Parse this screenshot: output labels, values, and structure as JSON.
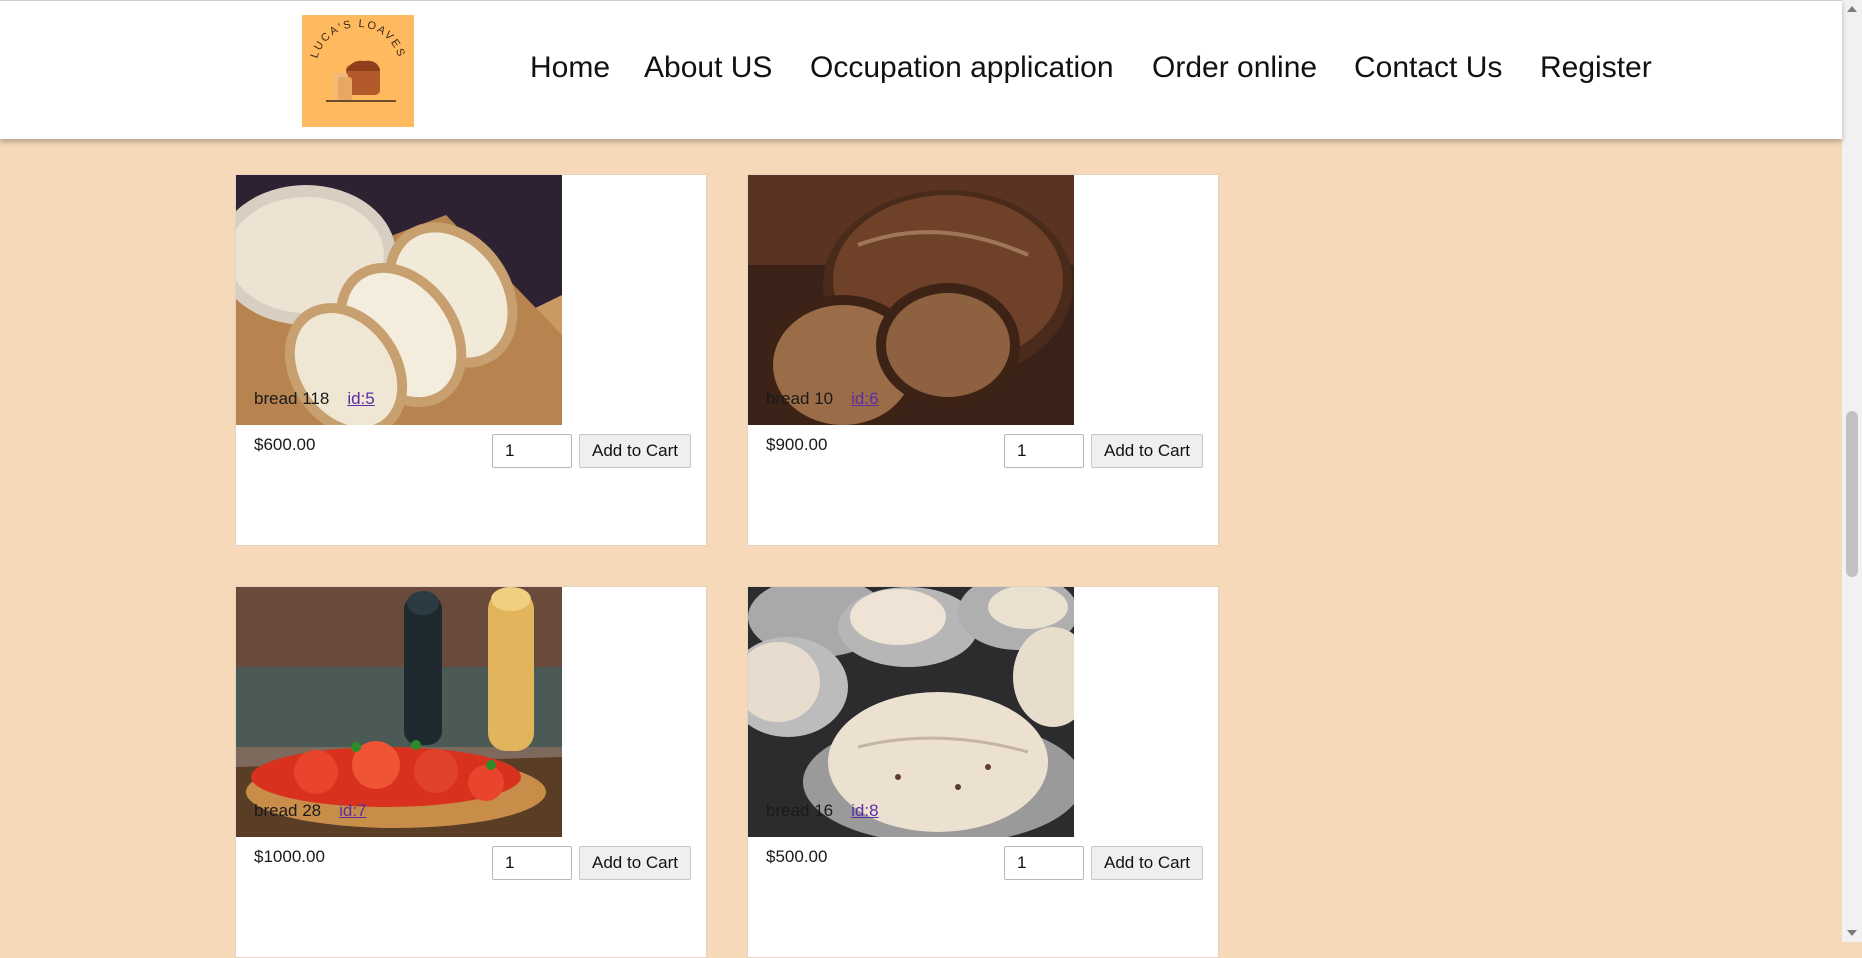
{
  "brand": {
    "logo_text": "LUCA'S LOAVES"
  },
  "nav": {
    "items": [
      "Home",
      "About US",
      "Occupation application",
      "Order online",
      "Contact Us",
      "Register"
    ]
  },
  "products": [
    {
      "name": "bread 118",
      "id_label": "id:5",
      "price": "$600.00",
      "qty": "1",
      "button": "Add to Cart"
    },
    {
      "name": "bread 10",
      "id_label": "id:6",
      "price": "$900.00",
      "qty": "1",
      "button": "Add to Cart"
    },
    {
      "name": "bread 28",
      "id_label": "id:7",
      "price": "$1000.00",
      "qty": "1",
      "button": "Add to Cart"
    },
    {
      "name": "bread 16",
      "id_label": "id:8",
      "price": "$500.00",
      "qty": "1",
      "button": "Add to Cart"
    }
  ],
  "colors": {
    "page_background": "#f5d9b9",
    "logo_background": "#ffb95e",
    "link": "#5b2ea6"
  }
}
